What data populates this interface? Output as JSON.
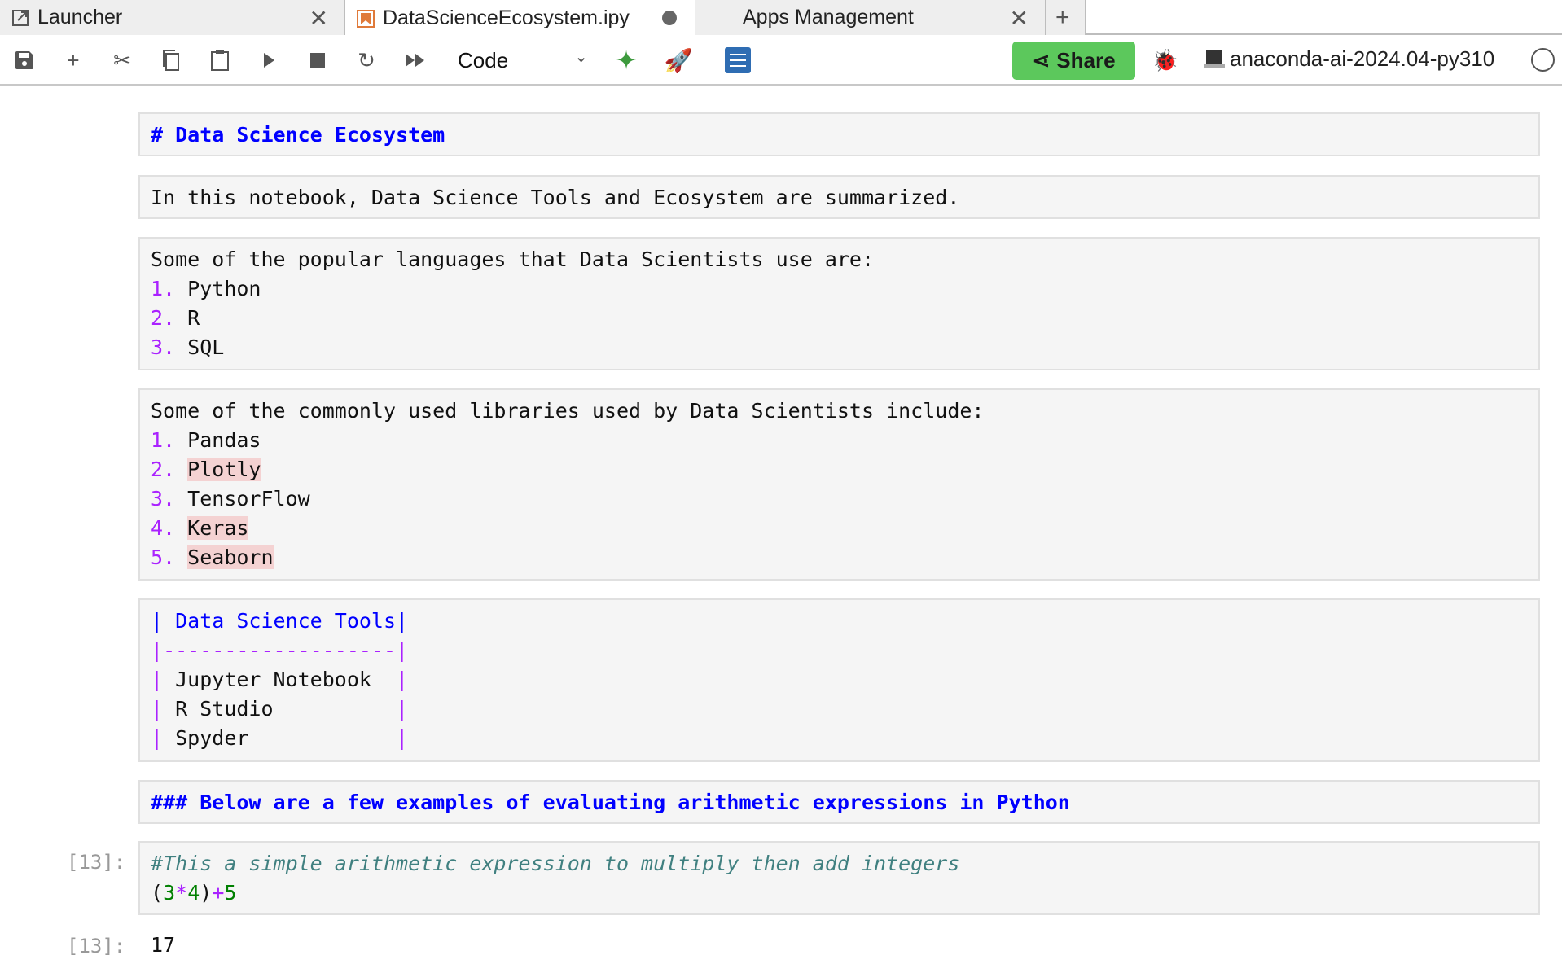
{
  "tabs": [
    {
      "label": "Launcher",
      "icon": "external-launch-icon",
      "closable": true
    },
    {
      "label": "DataScienceEcosystem.ipy",
      "icon": "notebook-icon",
      "unsaved": true,
      "active": true
    },
    {
      "label": "Apps Management",
      "closable": true
    }
  ],
  "toolbar": {
    "cell_type": "Code",
    "share_label": "Share",
    "kernel_name": "anaconda-ai-2024.04-py310",
    "accent": "#5cc85c"
  },
  "cells": {
    "c1": "# Data Science Ecosystem",
    "c2": "In this notebook, Data Science Tools and Ecosystem are summarized.",
    "c3": {
      "intro": "Some of the popular languages that Data Scientists use are:",
      "items": [
        "Python",
        "R",
        "SQL"
      ]
    },
    "c4": {
      "intro": "Some of the commonly used libraries used by Data Scientists include:",
      "items": [
        "Pandas",
        "Plotly",
        "TensorFlow",
        "Keras",
        "Seaborn"
      ]
    },
    "c5": {
      "header": " Data Science Tools",
      "sep": "-------------------",
      "rows": [
        " Jupyter Notebook  ",
        " R Studio          ",
        " Spyder            "
      ]
    },
    "c6": "### Below are a few examples of evaluating arithmetic expressions in Python",
    "code": {
      "prompt": "[13]:",
      "comment": "#This a simple arithmetic expression to multiply then add integers",
      "expr": [
        "(",
        "3",
        "*",
        "4",
        ")",
        "+",
        "5"
      ]
    },
    "output": {
      "prompt": "[13]:",
      "value": "17"
    }
  },
  "list_nums": [
    "1.",
    "2.",
    "3.",
    "4.",
    "5."
  ]
}
